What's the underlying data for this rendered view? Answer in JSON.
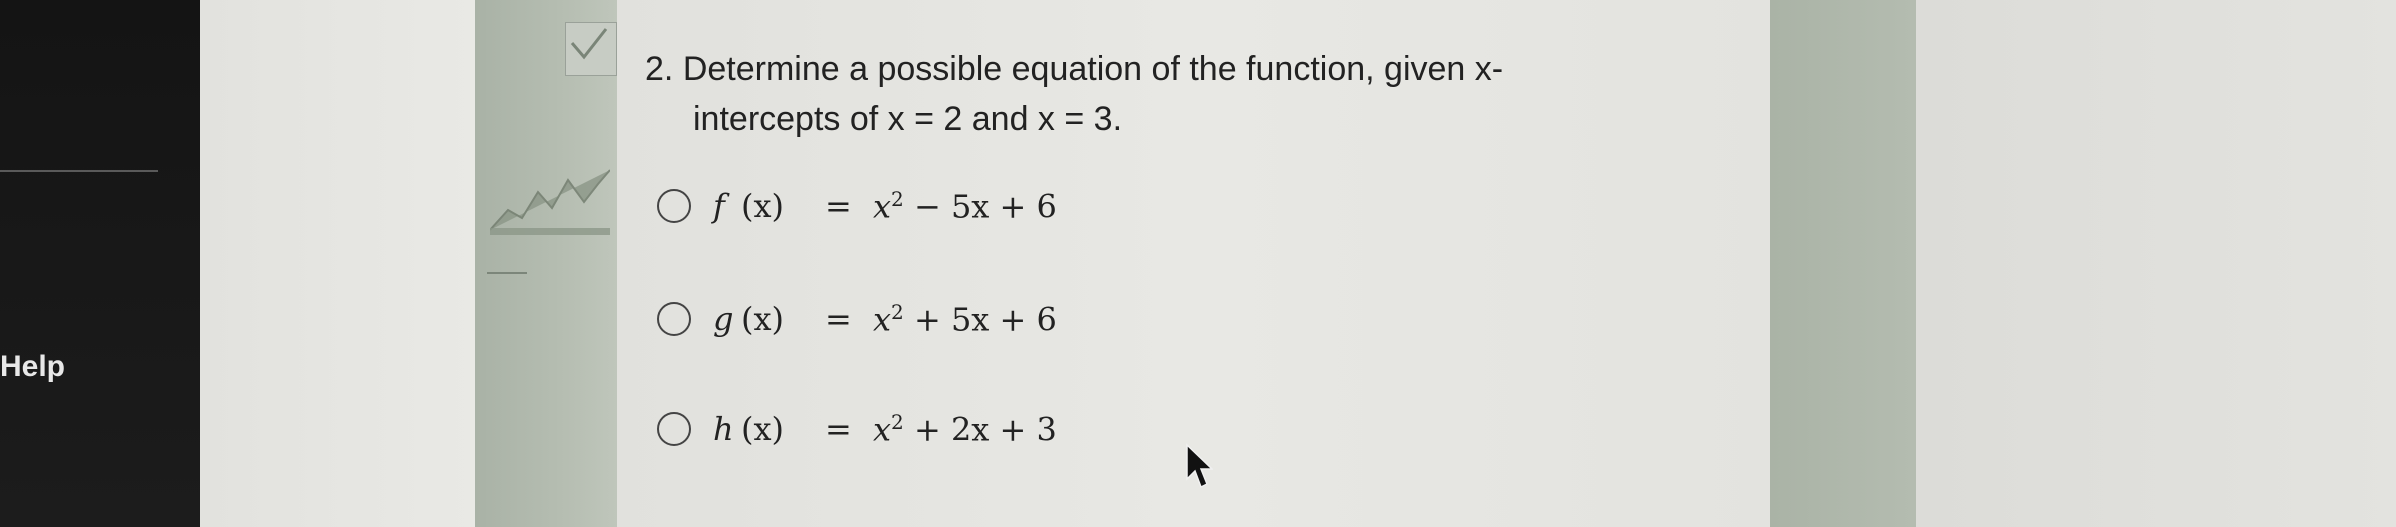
{
  "sidebar": {
    "help_label": "Help"
  },
  "question": {
    "number": "2.",
    "text_line1": "Determine a possible equation of the function, given x-",
    "text_line2": "intercepts of x = 2 and x = 3."
  },
  "options": [
    {
      "name": "f",
      "arg": "(x)",
      "eq": "=",
      "lead": "x",
      "exp": "2",
      "rest": " − 5x + 6"
    },
    {
      "name": "g",
      "arg": "(x)",
      "eq": "=",
      "lead": "x",
      "exp": "2",
      "rest": " + 5x + 6"
    },
    {
      "name": "h",
      "arg": "(x)",
      "eq": "=",
      "lead": "x",
      "exp": "2",
      "rest": " + 2x + 3"
    }
  ],
  "colors": {
    "dark_sidebar": "#141414",
    "green_strip": "#b0b9ac",
    "panel": "#e6e6e2",
    "text": "#222222"
  }
}
